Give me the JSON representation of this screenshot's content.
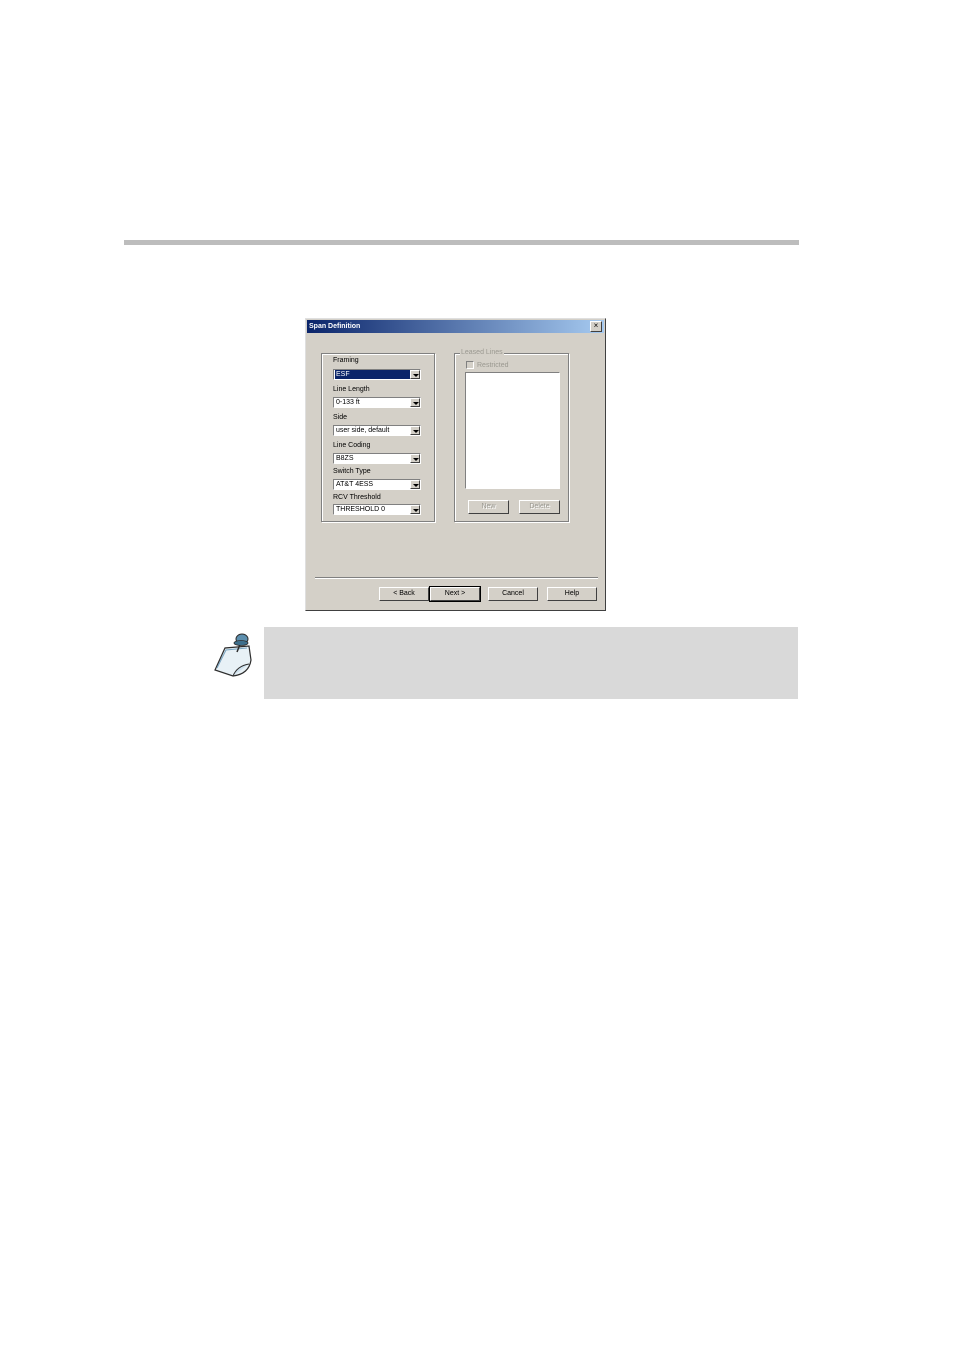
{
  "dialog": {
    "title": "Span Definition",
    "close_glyph": "×",
    "left_group": {
      "fields": [
        {
          "label": "Framing",
          "value": "ESF",
          "selected": true
        },
        {
          "label": "Line Length",
          "value": "0-133 ft"
        },
        {
          "label": "Side",
          "value": "user side, default"
        },
        {
          "label": "Line Coding",
          "value": "B8ZS"
        },
        {
          "label": "Switch Type",
          "value": "AT&T 4ESS"
        },
        {
          "label": "RCV Threshold",
          "value": "THRESHOLD 0"
        }
      ]
    },
    "leased_lines": {
      "caption": "Leased Lines",
      "restricted_label": "Restricted",
      "restricted_checked": false,
      "new_label": "New",
      "delete_label": "Delete"
    },
    "buttons": {
      "back": "< Back",
      "next": "Next >",
      "cancel": "Cancel",
      "help": "Help"
    }
  },
  "note": {
    "icon": "note-pin-icon",
    "text": ""
  },
  "colors": {
    "title_bar_start": "#0a246a",
    "title_bar_end": "#a6caf0",
    "dialog_face": "#d4d0c8",
    "note_background": "#d9d9d9",
    "page_rule": "#bdbdbd"
  }
}
